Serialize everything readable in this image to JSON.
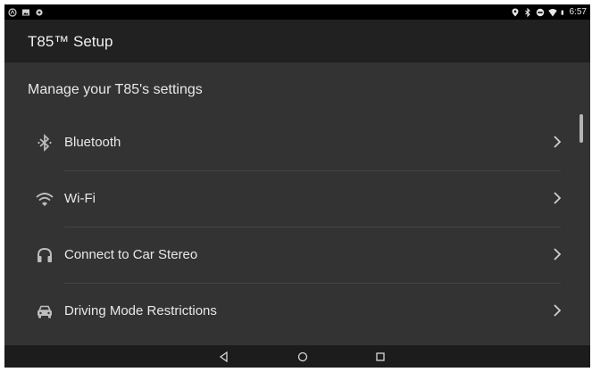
{
  "status_bar": {
    "left_icons": [
      "android-auto-icon",
      "image-icon",
      "sync-icon"
    ],
    "right_icons": [
      "location-icon",
      "bluetooth-icon",
      "do-not-disturb-icon",
      "wifi-icon",
      "battery-icon"
    ],
    "time": "6:57"
  },
  "app_bar": {
    "title": "T85™ Setup"
  },
  "settings": {
    "section_title": "Manage your T85's settings",
    "items": [
      {
        "label": "Bluetooth",
        "icon": "bluetooth-icon"
      },
      {
        "label": "Wi-Fi",
        "icon": "wifi-icon"
      },
      {
        "label": "Connect to Car Stereo",
        "icon": "headphones-icon"
      },
      {
        "label": "Driving Mode Restrictions",
        "icon": "car-icon"
      }
    ]
  },
  "nav_bar": {
    "buttons": [
      "back-icon",
      "home-icon",
      "recents-icon"
    ]
  },
  "colors": {
    "status_bar": "#000000",
    "app_bar": "#212121",
    "background": "#333333",
    "text": "#e8e8e8"
  }
}
